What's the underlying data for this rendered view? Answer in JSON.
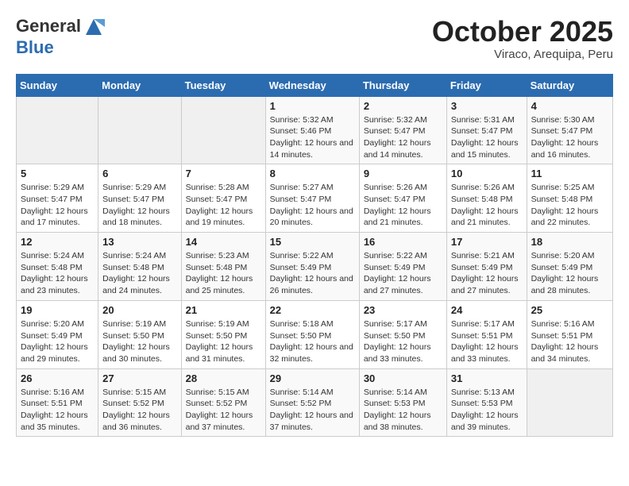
{
  "header": {
    "logo_line1": "General",
    "logo_line2": "Blue",
    "month_title": "October 2025",
    "subtitle": "Viraco, Arequipa, Peru"
  },
  "weekdays": [
    "Sunday",
    "Monday",
    "Tuesday",
    "Wednesday",
    "Thursday",
    "Friday",
    "Saturday"
  ],
  "weeks": [
    [
      {
        "day": "",
        "sunrise": "",
        "sunset": "",
        "daylight": ""
      },
      {
        "day": "",
        "sunrise": "",
        "sunset": "",
        "daylight": ""
      },
      {
        "day": "",
        "sunrise": "",
        "sunset": "",
        "daylight": ""
      },
      {
        "day": "1",
        "sunrise": "Sunrise: 5:32 AM",
        "sunset": "Sunset: 5:46 PM",
        "daylight": "Daylight: 12 hours and 14 minutes."
      },
      {
        "day": "2",
        "sunrise": "Sunrise: 5:32 AM",
        "sunset": "Sunset: 5:47 PM",
        "daylight": "Daylight: 12 hours and 14 minutes."
      },
      {
        "day": "3",
        "sunrise": "Sunrise: 5:31 AM",
        "sunset": "Sunset: 5:47 PM",
        "daylight": "Daylight: 12 hours and 15 minutes."
      },
      {
        "day": "4",
        "sunrise": "Sunrise: 5:30 AM",
        "sunset": "Sunset: 5:47 PM",
        "daylight": "Daylight: 12 hours and 16 minutes."
      }
    ],
    [
      {
        "day": "5",
        "sunrise": "Sunrise: 5:29 AM",
        "sunset": "Sunset: 5:47 PM",
        "daylight": "Daylight: 12 hours and 17 minutes."
      },
      {
        "day": "6",
        "sunrise": "Sunrise: 5:29 AM",
        "sunset": "Sunset: 5:47 PM",
        "daylight": "Daylight: 12 hours and 18 minutes."
      },
      {
        "day": "7",
        "sunrise": "Sunrise: 5:28 AM",
        "sunset": "Sunset: 5:47 PM",
        "daylight": "Daylight: 12 hours and 19 minutes."
      },
      {
        "day": "8",
        "sunrise": "Sunrise: 5:27 AM",
        "sunset": "Sunset: 5:47 PM",
        "daylight": "Daylight: 12 hours and 20 minutes."
      },
      {
        "day": "9",
        "sunrise": "Sunrise: 5:26 AM",
        "sunset": "Sunset: 5:47 PM",
        "daylight": "Daylight: 12 hours and 21 minutes."
      },
      {
        "day": "10",
        "sunrise": "Sunrise: 5:26 AM",
        "sunset": "Sunset: 5:48 PM",
        "daylight": "Daylight: 12 hours and 21 minutes."
      },
      {
        "day": "11",
        "sunrise": "Sunrise: 5:25 AM",
        "sunset": "Sunset: 5:48 PM",
        "daylight": "Daylight: 12 hours and 22 minutes."
      }
    ],
    [
      {
        "day": "12",
        "sunrise": "Sunrise: 5:24 AM",
        "sunset": "Sunset: 5:48 PM",
        "daylight": "Daylight: 12 hours and 23 minutes."
      },
      {
        "day": "13",
        "sunrise": "Sunrise: 5:24 AM",
        "sunset": "Sunset: 5:48 PM",
        "daylight": "Daylight: 12 hours and 24 minutes."
      },
      {
        "day": "14",
        "sunrise": "Sunrise: 5:23 AM",
        "sunset": "Sunset: 5:48 PM",
        "daylight": "Daylight: 12 hours and 25 minutes."
      },
      {
        "day": "15",
        "sunrise": "Sunrise: 5:22 AM",
        "sunset": "Sunset: 5:49 PM",
        "daylight": "Daylight: 12 hours and 26 minutes."
      },
      {
        "day": "16",
        "sunrise": "Sunrise: 5:22 AM",
        "sunset": "Sunset: 5:49 PM",
        "daylight": "Daylight: 12 hours and 27 minutes."
      },
      {
        "day": "17",
        "sunrise": "Sunrise: 5:21 AM",
        "sunset": "Sunset: 5:49 PM",
        "daylight": "Daylight: 12 hours and 27 minutes."
      },
      {
        "day": "18",
        "sunrise": "Sunrise: 5:20 AM",
        "sunset": "Sunset: 5:49 PM",
        "daylight": "Daylight: 12 hours and 28 minutes."
      }
    ],
    [
      {
        "day": "19",
        "sunrise": "Sunrise: 5:20 AM",
        "sunset": "Sunset: 5:49 PM",
        "daylight": "Daylight: 12 hours and 29 minutes."
      },
      {
        "day": "20",
        "sunrise": "Sunrise: 5:19 AM",
        "sunset": "Sunset: 5:50 PM",
        "daylight": "Daylight: 12 hours and 30 minutes."
      },
      {
        "day": "21",
        "sunrise": "Sunrise: 5:19 AM",
        "sunset": "Sunset: 5:50 PM",
        "daylight": "Daylight: 12 hours and 31 minutes."
      },
      {
        "day": "22",
        "sunrise": "Sunrise: 5:18 AM",
        "sunset": "Sunset: 5:50 PM",
        "daylight": "Daylight: 12 hours and 32 minutes."
      },
      {
        "day": "23",
        "sunrise": "Sunrise: 5:17 AM",
        "sunset": "Sunset: 5:50 PM",
        "daylight": "Daylight: 12 hours and 33 minutes."
      },
      {
        "day": "24",
        "sunrise": "Sunrise: 5:17 AM",
        "sunset": "Sunset: 5:51 PM",
        "daylight": "Daylight: 12 hours and 33 minutes."
      },
      {
        "day": "25",
        "sunrise": "Sunrise: 5:16 AM",
        "sunset": "Sunset: 5:51 PM",
        "daylight": "Daylight: 12 hours and 34 minutes."
      }
    ],
    [
      {
        "day": "26",
        "sunrise": "Sunrise: 5:16 AM",
        "sunset": "Sunset: 5:51 PM",
        "daylight": "Daylight: 12 hours and 35 minutes."
      },
      {
        "day": "27",
        "sunrise": "Sunrise: 5:15 AM",
        "sunset": "Sunset: 5:52 PM",
        "daylight": "Daylight: 12 hours and 36 minutes."
      },
      {
        "day": "28",
        "sunrise": "Sunrise: 5:15 AM",
        "sunset": "Sunset: 5:52 PM",
        "daylight": "Daylight: 12 hours and 37 minutes."
      },
      {
        "day": "29",
        "sunrise": "Sunrise: 5:14 AM",
        "sunset": "Sunset: 5:52 PM",
        "daylight": "Daylight: 12 hours and 37 minutes."
      },
      {
        "day": "30",
        "sunrise": "Sunrise: 5:14 AM",
        "sunset": "Sunset: 5:53 PM",
        "daylight": "Daylight: 12 hours and 38 minutes."
      },
      {
        "day": "31",
        "sunrise": "Sunrise: 5:13 AM",
        "sunset": "Sunset: 5:53 PM",
        "daylight": "Daylight: 12 hours and 39 minutes."
      },
      {
        "day": "",
        "sunrise": "",
        "sunset": "",
        "daylight": ""
      }
    ]
  ]
}
